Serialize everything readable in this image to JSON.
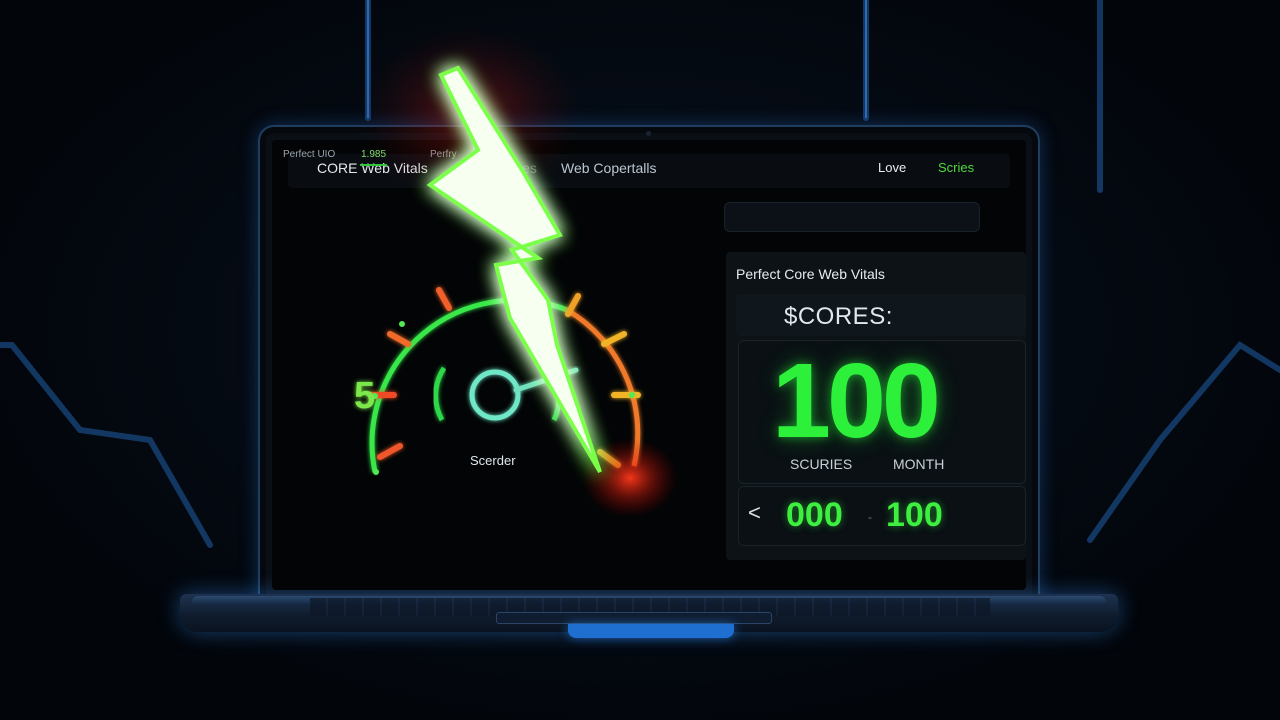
{
  "topbar": {
    "title": "CORE Web Vitals",
    "crumb_partial": "",
    "crumb_middle": "ices",
    "crumb_last": "Web Copertalls",
    "nav_love": "Love",
    "nav_scores": "Scries"
  },
  "toolbar": {
    "label": "Perfect UIO",
    "value": "1.985",
    "label2": "Perfry",
    "icon1": "clipboard-icon",
    "icon2": "arrow-right-icon"
  },
  "gauge": {
    "number": "5",
    "label": "Scerder",
    "colors": {
      "green": "#38e84a",
      "orange": "#f36b2a",
      "yellow": "#f0b428",
      "cyan": "#6fe8c8"
    }
  },
  "card": {
    "title": "Perfect Core Web Vitals",
    "scores_label": "$CORES:",
    "score": "100",
    "unit_left": "SCURIES",
    "unit_right": "MONTH",
    "range_arrow": "<",
    "range_from": "000",
    "range_sep": "-",
    "range_to": "100",
    "accent": "#2cf03a"
  }
}
